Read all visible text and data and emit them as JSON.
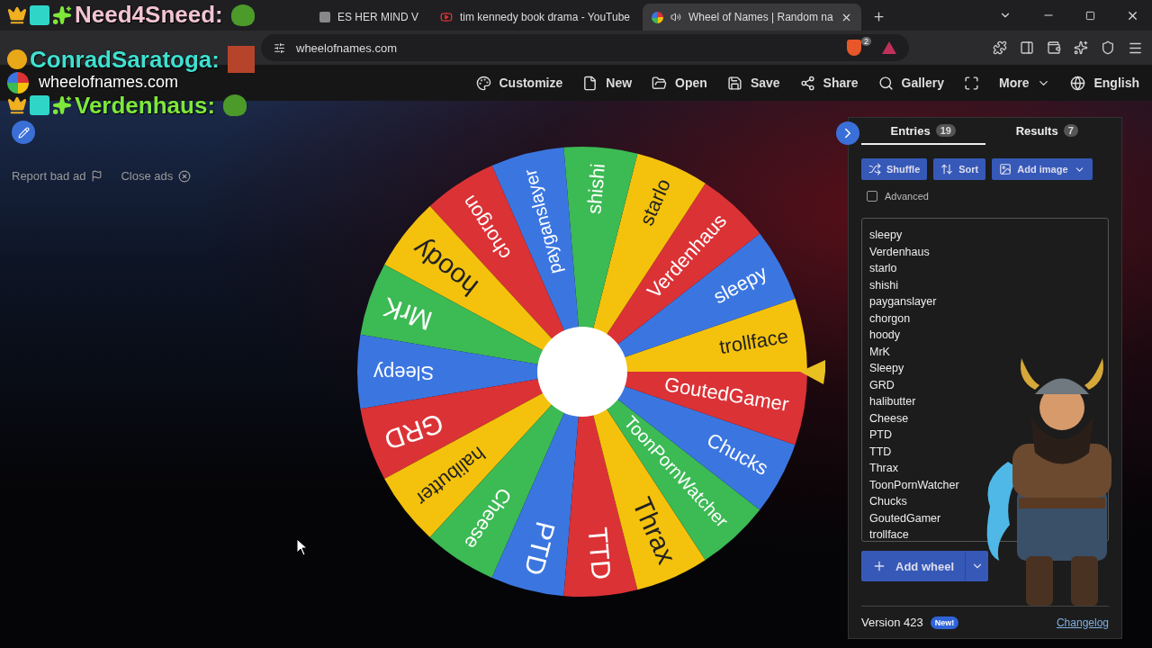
{
  "browser": {
    "tabs": [
      {
        "kind": "page",
        "title": "ES HER MIND V",
        "selected": false
      },
      {
        "kind": "youtube",
        "title": "tim kennedy book drama - YouTube",
        "selected": false
      },
      {
        "kind": "wheel",
        "title": "Wheel of Names | Random na",
        "selected": true
      }
    ],
    "address": "wheelofnames.com",
    "shield_count": "2"
  },
  "chat": [
    {
      "kind": "chat",
      "name": "Need4Sneed:",
      "color": "#f2c4d2"
    },
    {
      "kind": "chat",
      "name": "ConradSaratoga:",
      "color": "#3fe0d0"
    },
    {
      "kind": "site",
      "text": "wheelofnames.com"
    },
    {
      "kind": "chat",
      "name": "Verdenhaus:",
      "color": "#7ee83a"
    }
  ],
  "toolbar": [
    {
      "kind": "palette",
      "label": "Customize"
    },
    {
      "kind": "file",
      "label": "New"
    },
    {
      "kind": "folder",
      "label": "Open"
    },
    {
      "kind": "save",
      "label": "Save"
    },
    {
      "kind": "share",
      "label": "Share"
    },
    {
      "kind": "search",
      "label": "Gallery"
    },
    {
      "kind": "fullscreen"
    },
    {
      "kind": "menu",
      "label": "More"
    },
    {
      "kind": "globe",
      "label": "English"
    }
  ],
  "ads": {
    "report": "Report bad ad",
    "close": "Close ads"
  },
  "wheel": {
    "slices": [
      {
        "label": "trollface",
        "color": "#f4c20d"
      },
      {
        "label": "sleepy",
        "color": "#3b76e0"
      },
      {
        "label": "Verdenhaus",
        "color": "#db3236"
      },
      {
        "label": "starlo",
        "color": "#f4c20d"
      },
      {
        "label": "shishi",
        "color": "#3cba54"
      },
      {
        "label": "payganslayer",
        "color": "#3b76e0"
      },
      {
        "label": "chorgon",
        "color": "#db3236"
      },
      {
        "label": "hoody",
        "color": "#f4c20d"
      },
      {
        "label": "MrK",
        "color": "#3cba54"
      },
      {
        "label": "Sleepy",
        "color": "#3b76e0"
      },
      {
        "label": "GRD",
        "color": "#db3236"
      },
      {
        "label": "halibutter",
        "color": "#f4c20d"
      },
      {
        "label": "Cheese",
        "color": "#3cba54"
      },
      {
        "label": "PTD",
        "color": "#3b76e0"
      },
      {
        "label": "TTD",
        "color": "#db3236"
      },
      {
        "label": "Thrax",
        "color": "#f4c20d"
      },
      {
        "label": "ToonPornWatcher",
        "color": "#3cba54"
      },
      {
        "label": "Chucks",
        "color": "#3b76e0"
      },
      {
        "label": "GoutedGamer",
        "color": "#db3236"
      }
    ]
  },
  "panel": {
    "tabs": [
      {
        "label": "Entries",
        "count": "19",
        "selected": true
      },
      {
        "label": "Results",
        "count": "7",
        "selected": false
      }
    ],
    "actions": [
      {
        "kind": "shuffle",
        "label": "Shuffle"
      },
      {
        "kind": "sort",
        "label": "Sort"
      },
      {
        "kind": "image",
        "label": "Add image"
      }
    ],
    "advanced": {
      "label": "Advanced",
      "checked": false
    },
    "entries": [
      "sleepy",
      "Verdenhaus",
      "starlo",
      "shishi",
      "payganslayer",
      "chorgon",
      "hoody",
      "MrK",
      "Sleepy",
      "GRD",
      "halibutter",
      "Cheese",
      "PTD",
      "TTD",
      "Thrax",
      "ToonPornWatcher",
      "Chucks",
      "GoutedGamer",
      "trollface"
    ],
    "add_wheel": "Add wheel",
    "version": "Version 423",
    "badge": "New!",
    "changelog": "Changelog"
  }
}
